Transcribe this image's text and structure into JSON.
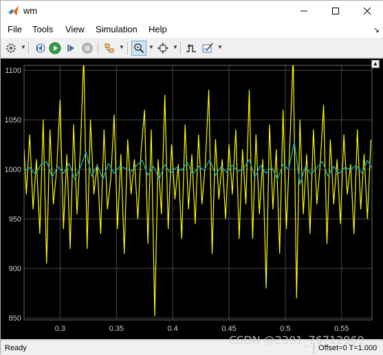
{
  "window": {
    "title": "wm"
  },
  "menu": {
    "file": "File",
    "tools": "Tools",
    "view": "View",
    "simulation": "Simulation",
    "help": "Help"
  },
  "toolbar": {
    "icons": [
      "gear-icon",
      "rewind-icon",
      "run-icon",
      "step-forward-icon",
      "stop-icon",
      "highlight-icon",
      "zoom-icon",
      "fit-to-view-icon",
      "triggers-icon",
      "style-icon"
    ]
  },
  "status": {
    "left": "Ready",
    "right": "Offset=0  T=1.000"
  },
  "watermark": "CSDN @2301_76712969",
  "colors": {
    "series_yellow": "#ffff00",
    "series_cyan": "#1ca0c8",
    "grid": "#4a4a4a",
    "background": "#000000",
    "axis_text": "#cfcfcf"
  },
  "chart_data": {
    "type": "line",
    "title": "",
    "xlabel": "",
    "ylabel": "",
    "xlim": [
      0.268,
      0.577
    ],
    "ylim": [
      848,
      1105
    ],
    "xticks": [
      "0.3",
      "0.35",
      "0.4",
      "0.45",
      "0.5",
      "0.55"
    ],
    "yticks": [
      "850",
      "900",
      "950",
      "1000",
      "1050",
      "1100"
    ],
    "grid": true,
    "series": [
      {
        "color": "#ffff00",
        "points": [
          [
            0.268,
            1020
          ],
          [
            0.27,
            975
          ],
          [
            0.273,
            1035
          ],
          [
            0.276,
            960
          ],
          [
            0.279,
            1010
          ],
          [
            0.282,
            935
          ],
          [
            0.285,
            1050
          ],
          [
            0.288,
            905
          ],
          [
            0.291,
            1040
          ],
          [
            0.294,
            965
          ],
          [
            0.297,
            1000
          ],
          [
            0.3,
            1070
          ],
          [
            0.303,
            940
          ],
          [
            0.306,
            1015
          ],
          [
            0.309,
            920
          ],
          [
            0.312,
            1045
          ],
          [
            0.315,
            955
          ],
          [
            0.318,
            1020
          ],
          [
            0.321,
            1115
          ],
          [
            0.324,
            920
          ],
          [
            0.327,
            1050
          ],
          [
            0.33,
            975
          ],
          [
            0.333,
            1005
          ],
          [
            0.336,
            935
          ],
          [
            0.339,
            1040
          ],
          [
            0.342,
            960
          ],
          [
            0.345,
            990
          ],
          [
            0.348,
            1055
          ],
          [
            0.351,
            940
          ],
          [
            0.354,
            1015
          ],
          [
            0.357,
            915
          ],
          [
            0.36,
            1030
          ],
          [
            0.363,
            975
          ],
          [
            0.366,
            1010
          ],
          [
            0.369,
            950
          ],
          [
            0.372,
            1020
          ],
          [
            0.375,
            1060
          ],
          [
            0.378,
            925
          ],
          [
            0.381,
            1040
          ],
          [
            0.384,
            852
          ],
          [
            0.387,
            1010
          ],
          [
            0.39,
            955
          ],
          [
            0.393,
            1075
          ],
          [
            0.396,
            940
          ],
          [
            0.399,
            1025
          ],
          [
            0.402,
            970
          ],
          [
            0.405,
            1005
          ],
          [
            0.408,
            930
          ],
          [
            0.411,
            1045
          ],
          [
            0.414,
            960
          ],
          [
            0.417,
            1015
          ],
          [
            0.42,
            945
          ],
          [
            0.423,
            1035
          ],
          [
            0.426,
            965
          ],
          [
            0.429,
            1005
          ],
          [
            0.432,
            1080
          ],
          [
            0.435,
            915
          ],
          [
            0.438,
            1030
          ],
          [
            0.441,
            970
          ],
          [
            0.444,
            1010
          ],
          [
            0.447,
            950
          ],
          [
            0.45,
            1025
          ],
          [
            0.453,
            975
          ],
          [
            0.456,
            1040
          ],
          [
            0.459,
            930
          ],
          [
            0.462,
            1020
          ],
          [
            0.465,
            965
          ],
          [
            0.468,
            1080
          ],
          [
            0.471,
            930
          ],
          [
            0.474,
            1035
          ],
          [
            0.477,
            955
          ],
          [
            0.48,
            1010
          ],
          [
            0.483,
            880
          ],
          [
            0.486,
            1045
          ],
          [
            0.489,
            960
          ],
          [
            0.492,
            1020
          ],
          [
            0.495,
            915
          ],
          [
            0.498,
            1060
          ],
          [
            0.501,
            940
          ],
          [
            0.504,
            1025
          ],
          [
            0.507,
            1115
          ],
          [
            0.51,
            870
          ],
          [
            0.513,
            1050
          ],
          [
            0.516,
            955
          ],
          [
            0.519,
            1015
          ],
          [
            0.522,
            935
          ],
          [
            0.525,
            1040
          ],
          [
            0.528,
            965
          ],
          [
            0.531,
            1005
          ],
          [
            0.534,
            1065
          ],
          [
            0.537,
            925
          ],
          [
            0.54,
            1030
          ],
          [
            0.543,
            965
          ],
          [
            0.546,
            1010
          ],
          [
            0.549,
            945
          ],
          [
            0.552,
            1035
          ],
          [
            0.555,
            975
          ],
          [
            0.558,
            1005
          ],
          [
            0.561,
            935
          ],
          [
            0.564,
            1040
          ],
          [
            0.567,
            960
          ],
          [
            0.57,
            1015
          ],
          [
            0.573,
            950
          ],
          [
            0.576,
            1030
          ]
        ]
      },
      {
        "color": "#1ca0c8",
        "points": [
          [
            0.268,
            998
          ],
          [
            0.273,
            1002
          ],
          [
            0.278,
            995
          ],
          [
            0.283,
            1005
          ],
          [
            0.288,
            1008
          ],
          [
            0.293,
            992
          ],
          [
            0.298,
            1003
          ],
          [
            0.303,
            996
          ],
          [
            0.308,
            1006
          ],
          [
            0.313,
            990
          ],
          [
            0.318,
            1002
          ],
          [
            0.323,
            1018
          ],
          [
            0.328,
            993
          ],
          [
            0.333,
            1004
          ],
          [
            0.338,
            990
          ],
          [
            0.343,
            1006
          ],
          [
            0.348,
            996
          ],
          [
            0.353,
            1003
          ],
          [
            0.358,
            1001
          ],
          [
            0.363,
            998
          ],
          [
            0.368,
            1004
          ],
          [
            0.373,
            1009
          ],
          [
            0.378,
            994
          ],
          [
            0.383,
            1003
          ],
          [
            0.388,
            990
          ],
          [
            0.393,
            1005
          ],
          [
            0.398,
            996
          ],
          [
            0.403,
            1002
          ],
          [
            0.408,
            999
          ],
          [
            0.413,
            1007
          ],
          [
            0.418,
            995
          ],
          [
            0.423,
            1003
          ],
          [
            0.428,
            999
          ],
          [
            0.433,
            1010
          ],
          [
            0.438,
            994
          ],
          [
            0.443,
            1003
          ],
          [
            0.448,
            997
          ],
          [
            0.453,
            1004
          ],
          [
            0.458,
            998
          ],
          [
            0.463,
            1001
          ],
          [
            0.468,
            1010
          ],
          [
            0.473,
            992
          ],
          [
            0.478,
            1004
          ],
          [
            0.483,
            996
          ],
          [
            0.488,
            1002
          ],
          [
            0.493,
            990
          ],
          [
            0.498,
            1005
          ],
          [
            0.503,
            1000
          ],
          [
            0.508,
            1028
          ],
          [
            0.513,
            985
          ],
          [
            0.518,
            1003
          ],
          [
            0.523,
            995
          ],
          [
            0.528,
            1002
          ],
          [
            0.533,
            1008
          ],
          [
            0.538,
            993
          ],
          [
            0.543,
            1003
          ],
          [
            0.548,
            996
          ],
          [
            0.553,
            1002
          ],
          [
            0.558,
            1000
          ],
          [
            0.563,
            1004
          ],
          [
            0.568,
            996
          ],
          [
            0.573,
            1009
          ],
          [
            0.577,
            1001
          ]
        ]
      }
    ]
  }
}
